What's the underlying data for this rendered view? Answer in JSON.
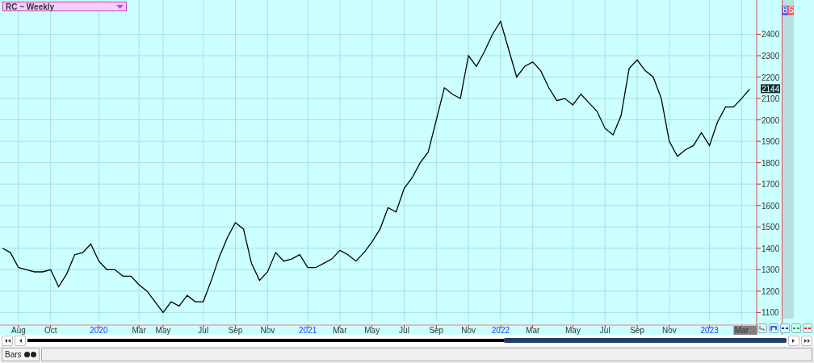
{
  "symbol_dropdown": {
    "label": "RC ~ Weekly"
  },
  "side_badges": [
    {
      "label": "B",
      "color": "#5566ff"
    },
    {
      "label": "S",
      "color": "#ee6666"
    }
  ],
  "chart": {
    "last_price": "2144",
    "chart_data": {
      "type": "line",
      "grid": true,
      "ylim": [
        1060,
        2560
      ],
      "yticks": [
        1100,
        1200,
        1300,
        1400,
        1500,
        1600,
        1700,
        1800,
        1900,
        2000,
        2100,
        2200,
        2300,
        2400
      ],
      "categories": [
        null,
        null,
        "Aug",
        null,
        null,
        null,
        "Oct",
        null,
        null,
        null,
        null,
        null,
        "2020",
        null,
        null,
        null,
        null,
        "Mar",
        null,
        null,
        "May",
        null,
        null,
        null,
        null,
        "Jul",
        null,
        null,
        null,
        "Sep",
        null,
        null,
        null,
        "Nov",
        null,
        null,
        null,
        null,
        "2021",
        null,
        null,
        null,
        "Mar",
        null,
        null,
        null,
        "May",
        null,
        null,
        null,
        "Jul",
        null,
        null,
        null,
        "Sep",
        null,
        null,
        null,
        "Nov",
        null,
        null,
        null,
        "2022",
        null,
        null,
        null,
        "Mar",
        null,
        null,
        null,
        null,
        "May",
        null,
        null,
        null,
        "Jul",
        null,
        null,
        null,
        "Sep",
        null,
        null,
        null,
        "Nov",
        null,
        null,
        null,
        null,
        "2023",
        null,
        null,
        null,
        "Mar",
        null
      ],
      "series": [
        {
          "color": "#000000",
          "values": [
            1400,
            1380,
            1310,
            1300,
            1290,
            1290,
            1300,
            1220,
            1280,
            1370,
            1380,
            1420,
            1340,
            1300,
            1300,
            1270,
            1270,
            1230,
            1200,
            1150,
            1100,
            1150,
            1130,
            1180,
            1150,
            1150,
            1250,
            1360,
            1450,
            1520,
            1490,
            1330,
            1250,
            1290,
            1380,
            1340,
            1350,
            1370,
            1310,
            1310,
            1330,
            1350,
            1390,
            1370,
            1340,
            1380,
            1430,
            1490,
            1590,
            1570,
            1680,
            1730,
            1800,
            1850,
            2000,
            2150,
            2120,
            2100,
            2300,
            2250,
            2320,
            2400,
            2460,
            2330,
            2200,
            2250,
            2270,
            2230,
            2150,
            2090,
            2100,
            2070,
            2120,
            2080,
            2040,
            1960,
            1930,
            2020,
            2240,
            2280,
            2230,
            2200,
            2100,
            1900,
            1830,
            1860,
            1880,
            1940,
            1880,
            1990,
            2060,
            2060,
            2100,
            2144
          ]
        }
      ]
    }
  },
  "status_bar": {
    "tabs": [
      {
        "label": "Bars"
      }
    ]
  }
}
